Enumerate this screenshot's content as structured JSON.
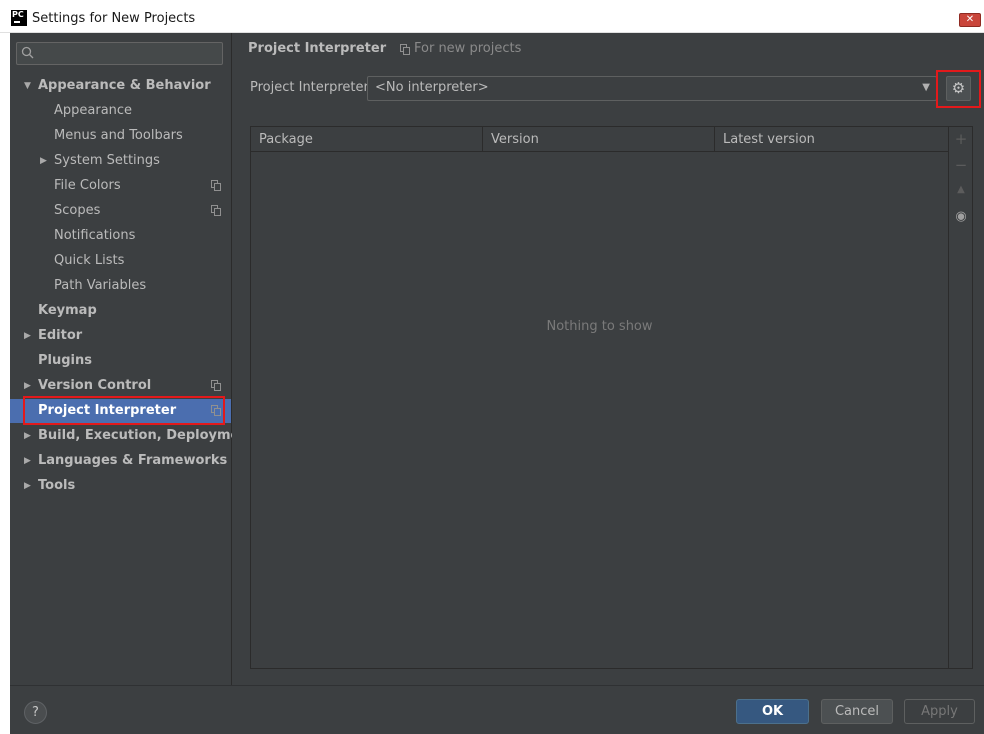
{
  "window": {
    "title": "Settings for New Projects",
    "logo_text": "PC",
    "close_glyph": "✕"
  },
  "sidebar": {
    "search": {
      "placeholder": ""
    },
    "items": [
      {
        "label": "Appearance & Behavior",
        "arrow": "▼",
        "bold": true
      },
      {
        "label": "Appearance"
      },
      {
        "label": "Menus and Toolbars"
      },
      {
        "label": "System Settings",
        "arrow": "▶"
      },
      {
        "label": "File Colors",
        "copy_icon": true
      },
      {
        "label": "Scopes",
        "copy_icon": true
      },
      {
        "label": "Notifications"
      },
      {
        "label": "Quick Lists"
      },
      {
        "label": "Path Variables"
      },
      {
        "label": "Keymap",
        "bold": true
      },
      {
        "label": "Editor",
        "arrow": "▶",
        "bold": true
      },
      {
        "label": "Plugins",
        "bold": true
      },
      {
        "label": "Version Control",
        "arrow": "▶",
        "bold": true,
        "copy_icon": true
      },
      {
        "label": "Project Interpreter",
        "bold": true,
        "copy_icon": true,
        "selected": true
      },
      {
        "label": "Build, Execution, Deployment",
        "arrow": "▶",
        "bold": true
      },
      {
        "label": "Languages & Frameworks",
        "arrow": "▶",
        "bold": true
      },
      {
        "label": "Tools",
        "arrow": "▶",
        "bold": true
      }
    ]
  },
  "content": {
    "title": "Project Interpreter",
    "scope_note": "For new projects",
    "interpreter_label": "Project Interpreter:",
    "interpreter_value": "<No interpreter>",
    "table": {
      "columns": [
        "Package",
        "Version",
        "Latest version"
      ],
      "empty_message": "Nothing to show",
      "tools": [
        "+",
        "−",
        "▲",
        "◉"
      ]
    }
  },
  "footer": {
    "help": "?",
    "ok": "OK",
    "cancel": "Cancel",
    "apply": "Apply"
  },
  "colors": {
    "background": "#3c3f41",
    "selection": "#4b6eaf",
    "highlight_box": "#e3191b",
    "primary_button": "#365880"
  }
}
